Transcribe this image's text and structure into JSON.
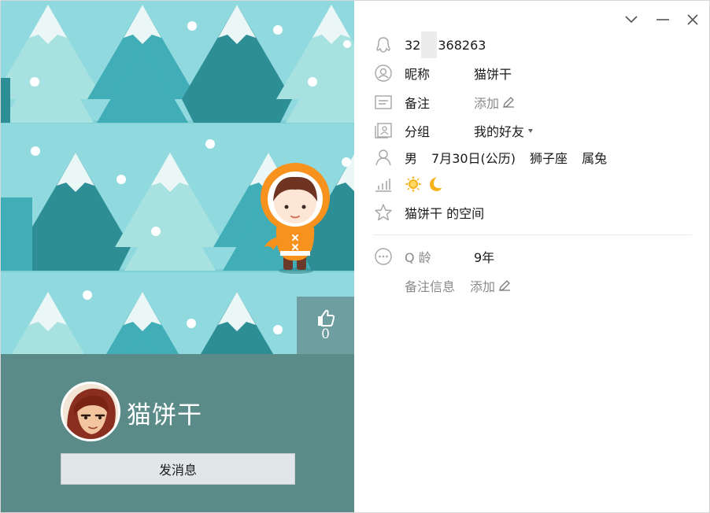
{
  "window_controls": {
    "collapse": "chevron-down-icon",
    "minimize": "minimize-icon",
    "close": "close-icon"
  },
  "profile": {
    "display_name": "猫饼干",
    "message_button": "发消息",
    "like_count": "0"
  },
  "details": {
    "qq_number_prefix": "32",
    "qq_number_suffix": "368263",
    "nickname_label": "昵称",
    "nickname_value": "猫饼干",
    "remark_label": "备注",
    "remark_value": "添加",
    "group_label": "分组",
    "group_value": "我的好友",
    "gender": "男",
    "birthday": "7月30日(公历)",
    "zodiac": "狮子座",
    "chinese_zodiac": "属兔",
    "space_link": "猫饼干 的空间",
    "qage_label": "Q 龄",
    "qage_value": "9年",
    "remark_info_label": "备注信息",
    "remark_info_value": "添加"
  },
  "colors": {
    "banner_bg": "#8fd9df",
    "tree_dark": "#2e8e96",
    "tree_mid": "#41aeb7",
    "tree_light": "#a7e2e0",
    "bottom_panel": "#5b8b88",
    "kid_coat": "#f7921e"
  }
}
